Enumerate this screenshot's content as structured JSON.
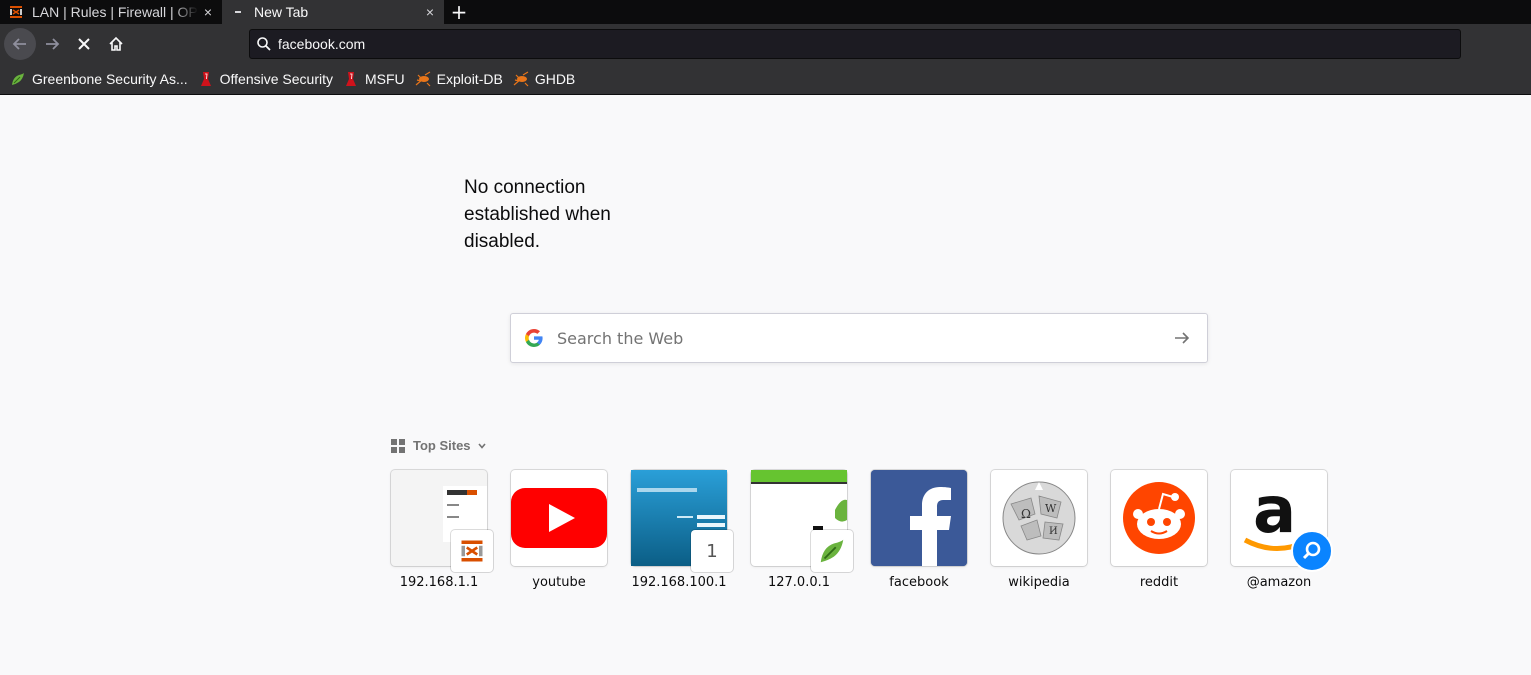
{
  "tabs": [
    {
      "title": "LAN | Rules | Firewall | OPNsense",
      "icon": "opnsense-icon",
      "close": "×"
    },
    {
      "title": "New Tab",
      "icon": "dash-icon",
      "close": "×"
    }
  ],
  "newtab_label": "+",
  "urlbar": {
    "value": "facebook.com"
  },
  "bookmarks": [
    {
      "label": "Greenbone Security As...",
      "icon": "greenbone-icon"
    },
    {
      "label": "Offensive Security",
      "icon": "offsec-icon"
    },
    {
      "label": "MSFU",
      "icon": "msfu-icon"
    },
    {
      "label": "Exploit-DB",
      "icon": "exploitdb-icon"
    },
    {
      "label": "GHDB",
      "icon": "ghdb-icon"
    }
  ],
  "annotation": "No connection\nestablished when\ndisabled.",
  "search": {
    "placeholder": "Search the Web"
  },
  "topsites": {
    "header": "Top Sites",
    "tiles": [
      {
        "label": "192.168.1.1"
      },
      {
        "label": "youtube"
      },
      {
        "label": "192.168.100.1",
        "badge": "1"
      },
      {
        "label": "127.0.0.1"
      },
      {
        "label": "facebook"
      },
      {
        "label": "wikipedia"
      },
      {
        "label": "reddit"
      },
      {
        "label": "@amazon"
      }
    ]
  },
  "colors": {
    "accent": "#0a84ff",
    "youtube": "#ff0000",
    "facebook": "#3b5998",
    "reddit": "#ff4500"
  }
}
